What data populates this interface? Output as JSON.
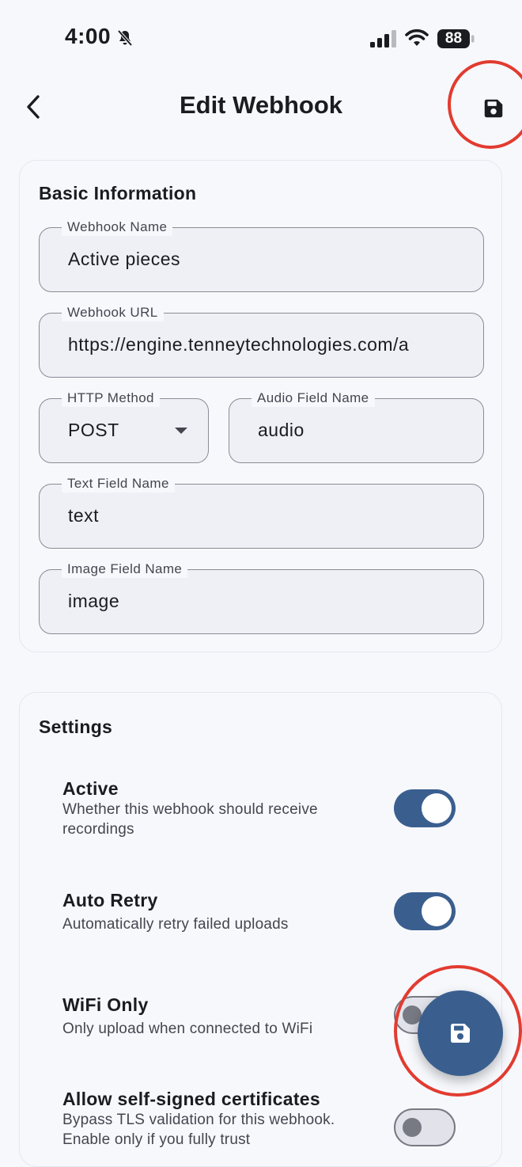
{
  "status_bar": {
    "time": "4:00",
    "battery": "88"
  },
  "app_bar": {
    "title": "Edit Webhook"
  },
  "basic_info": {
    "title": "Basic Information",
    "webhook_name": {
      "label": "Webhook Name",
      "value": "Active pieces"
    },
    "webhook_url": {
      "label": "Webhook URL",
      "value": "https://engine.tenneytechnologies.com/a"
    },
    "http_method": {
      "label": "HTTP Method",
      "value": "POST"
    },
    "audio_field": {
      "label": "Audio Field Name",
      "value": "audio"
    },
    "text_field": {
      "label": "Text Field Name",
      "value": "text"
    },
    "image_field": {
      "label": "Image Field Name",
      "value": "image"
    }
  },
  "settings": {
    "title": "Settings",
    "items": [
      {
        "title": "Active",
        "description": "Whether this webhook should receive recordings",
        "enabled": true
      },
      {
        "title": "Auto Retry",
        "description": "Automatically retry failed uploads",
        "enabled": true
      },
      {
        "title": "WiFi Only",
        "description": "Only upload when connected to WiFi",
        "enabled": false
      },
      {
        "title": "Allow self-signed certificates",
        "description": "Bypass TLS validation for this webhook. Enable only if you fully trust",
        "enabled": false
      }
    ]
  },
  "colors": {
    "accent": "#3a5f8f",
    "highlight_ring": "#e23b30",
    "background": "#f7f8fc"
  },
  "icons": {
    "back": "chevron-left-icon",
    "save": "floppy-disk-icon",
    "dropdown": "caret-down-icon"
  }
}
